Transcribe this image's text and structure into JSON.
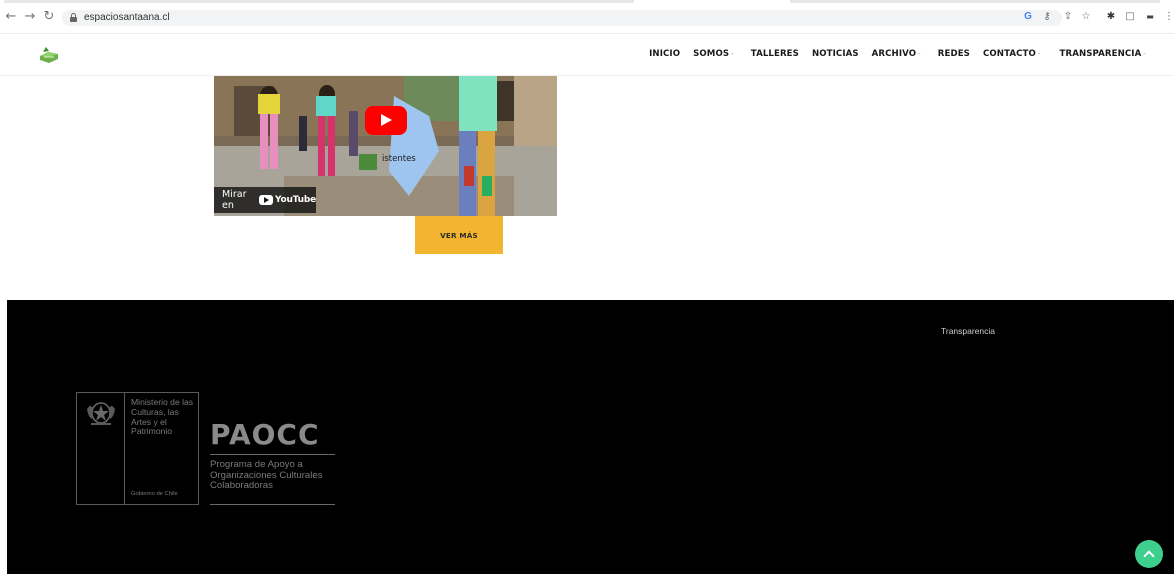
{
  "browser": {
    "url": "espaciosantaana.cl",
    "icons": [
      "back-icon",
      "forward-icon",
      "reload-icon",
      "lock-icon",
      "google-icon",
      "key-icon",
      "share-icon",
      "star-icon",
      "extensions-icon",
      "sidepanel-icon"
    ]
  },
  "header": {
    "logo": "site-logo",
    "nav": [
      {
        "label": "INICIO",
        "dropdown": false
      },
      {
        "label": "SOMOS",
        "dropdown": true
      },
      {
        "label": "TALLERES",
        "dropdown": false
      },
      {
        "label": "NOTICIAS",
        "dropdown": false
      },
      {
        "label": "ARCHIVO",
        "dropdown": true
      },
      {
        "label": "REDES",
        "dropdown": false
      },
      {
        "label": "CONTACTO",
        "dropdown": true
      },
      {
        "label": "TRANSPARENCIA",
        "dropdown": true
      }
    ],
    "caret": "-"
  },
  "video": {
    "watch_on": "Mirar en",
    "youtube": "YouTube",
    "overlay_text": "istentes"
  },
  "main": {
    "ver_mas": "VER MÁS",
    "ver_mas_color": "#f3b52f"
  },
  "footer": {
    "link": "Transparencia",
    "ministry": "Ministerio de las Culturas, las Artes y el Patrimonio",
    "gobierno": "Gobierno de Chile",
    "paocc": "PAOCC",
    "program": "Programa de Apoyo a Organizaciones Culturales Colaboradoras",
    "scroll_top_color": "#3ecf8e"
  }
}
